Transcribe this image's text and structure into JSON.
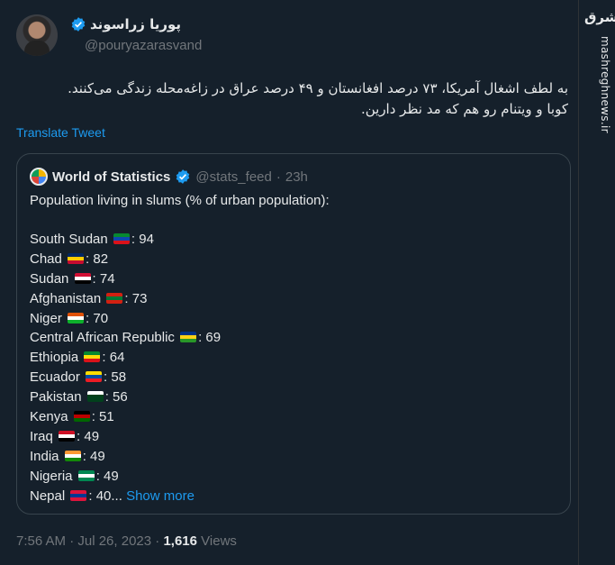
{
  "watermark": {
    "logo": "مشرق",
    "site": "mashreghnews.ir"
  },
  "author": {
    "name": "پوریا زراسوند",
    "handle": "@pouryazarasvand"
  },
  "tweet": {
    "line1": "به لطف اشغال آمریکا، ۷۳ درصد افغانستان و ۴۹ درصد عراق در زاغه‌محله زندگی می‌کنند.",
    "line2": "کوبا و ویتنام رو هم که مد نظر دارین.",
    "translate": "Translate Tweet"
  },
  "quote": {
    "name": "World of Statistics",
    "handle": "@stats_feed",
    "dot": "·",
    "time": "23h",
    "intro": "Population living in slums (% of urban population):",
    "rows": [
      {
        "country": "South Sudan",
        "value": ": 94",
        "flag": [
          "#078930",
          "#0f47af",
          "#da121a"
        ]
      },
      {
        "country": "Chad",
        "value": ": 82",
        "flag": [
          "#002664",
          "#fecb00",
          "#c60c30"
        ]
      },
      {
        "country": "Sudan",
        "value": ": 74",
        "flag": [
          "#d21034",
          "#ffffff",
          "#000000"
        ]
      },
      {
        "country": "Afghanistan",
        "value": ": 73",
        "flag": [
          "#d32011",
          "#007a36",
          "#d32011"
        ]
      },
      {
        "country": "Niger",
        "value": ": 70",
        "flag": [
          "#e05206",
          "#ffffff",
          "#0db02b"
        ]
      },
      {
        "country": "Central African Republic",
        "value": ": 69",
        "flag": [
          "#003082",
          "#fcd116",
          "#289728"
        ]
      },
      {
        "country": "Ethiopia",
        "value": ": 64",
        "flag": [
          "#078930",
          "#fcdd09",
          "#da121a"
        ]
      },
      {
        "country": "Ecuador",
        "value": ": 58",
        "flag": [
          "#ffdd00",
          "#034ea2",
          "#ed1c24"
        ]
      },
      {
        "country": "Pakistan",
        "value": ": 56",
        "flag": [
          "#ffffff",
          "#01411c",
          "#01411c"
        ]
      },
      {
        "country": "Kenya",
        "value": ": 51",
        "flag": [
          "#000000",
          "#bb0000",
          "#006600"
        ]
      },
      {
        "country": "Iraq",
        "value": ": 49",
        "flag": [
          "#ce1126",
          "#ffffff",
          "#000000"
        ]
      },
      {
        "country": "India",
        "value": ": 49",
        "flag": [
          "#ff9933",
          "#ffffff",
          "#138808"
        ]
      },
      {
        "country": "Nigeria",
        "value": ": 49",
        "flag": [
          "#008751",
          "#ffffff",
          "#008751"
        ]
      },
      {
        "country": "Nepal",
        "value": ": 40...",
        "flag": [
          "#dc143c",
          "#003893",
          "#dc143c"
        ]
      }
    ],
    "show_more": "Show more"
  },
  "meta": {
    "time": "7:56 AM · Jul 26, 2023 ·",
    "views_count": "1,616",
    "views_label": "Views"
  },
  "colors": {
    "background": "#15202b",
    "accent": "#1d9bf0",
    "muted": "#71767b",
    "border": "#38444d"
  }
}
